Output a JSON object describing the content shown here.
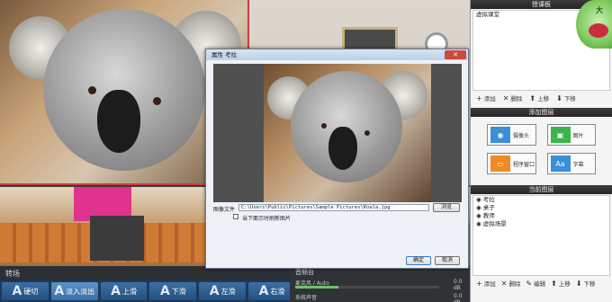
{
  "top_panel": {
    "header": "授课板",
    "list_items": [
      "虚拟课堂"
    ],
    "ops": [
      {
        "icon": "plus-icon",
        "label": "添加"
      },
      {
        "icon": "x-icon",
        "label": "删除"
      },
      {
        "icon": "arrow-up-icon",
        "label": "上移"
      },
      {
        "icon": "arrow-down-icon",
        "label": "下移"
      }
    ]
  },
  "add_layer": {
    "header": "添加图层",
    "buttons": [
      {
        "label": "摄像头",
        "color": "#3a8fd6",
        "icon": "camera-icon"
      },
      {
        "label": "图片",
        "color": "#39b54a",
        "icon": "image-icon"
      },
      {
        "label": "程序窗口",
        "color": "#f08a24",
        "icon": "window-icon"
      },
      {
        "label": "字幕",
        "color": "#3a8fd6",
        "icon": "text-icon"
      }
    ]
  },
  "current_layers": {
    "header": "当前图层",
    "items": [
      "考拉",
      "桌子",
      "教师",
      "虚拟场景"
    ],
    "ops": [
      {
        "icon": "plus-icon",
        "label": "添加"
      },
      {
        "icon": "x-icon",
        "label": "删除"
      },
      {
        "icon": "wrench-icon",
        "label": "编辑"
      },
      {
        "icon": "arrow-up-icon",
        "label": "上移"
      },
      {
        "icon": "arrow-down-icon",
        "label": "下移"
      }
    ]
  },
  "transitions": {
    "title": "转场",
    "buttons": [
      {
        "glyph": "A",
        "label": "硬切"
      },
      {
        "glyph": "A",
        "label": "淡入淡出"
      },
      {
        "glyph": "A",
        "label": "上滑"
      },
      {
        "glyph": "A",
        "label": "下滑"
      },
      {
        "glyph": "A",
        "label": "左滑"
      },
      {
        "glyph": "A",
        "label": "右滑"
      }
    ]
  },
  "audio": {
    "title": "音频台",
    "mic_label": "麦克风 / Auto",
    "mic_value": "0.0 dB",
    "system_label": "系统声音",
    "system_value": "0.0 dB"
  },
  "dialog": {
    "title": "属性 考拉",
    "close_label": "✕",
    "file_label": "图像文件",
    "file_path": "C:\\Users\\Public\\Pictures\\Sample Pictures\\Koala.jpg",
    "browse_label": "浏览",
    "checkbox_label": "当下面示时刷新图片",
    "ok_label": "确定",
    "cancel_label": "取消"
  },
  "logo_text": "大"
}
